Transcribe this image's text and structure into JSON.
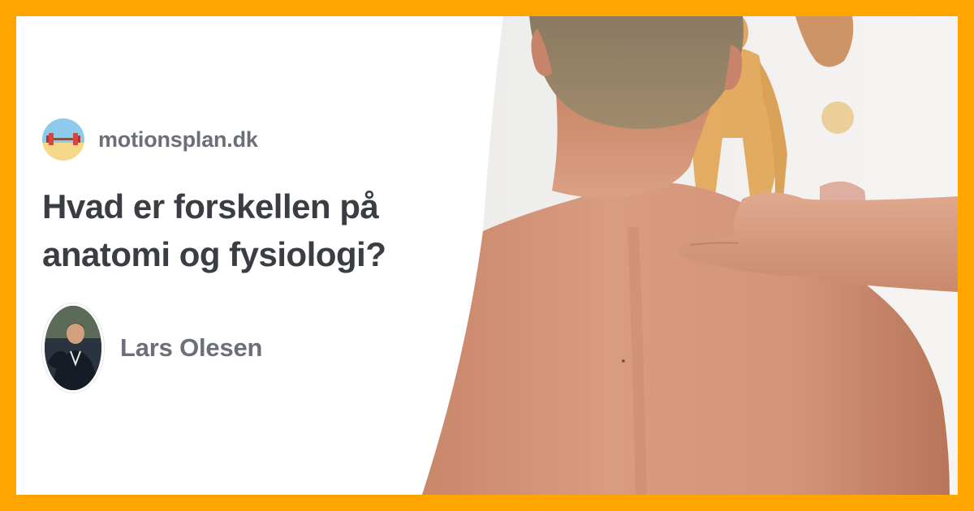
{
  "site": {
    "name": "motionsplan.dk",
    "logo_icon": "dumbbell-beach-icon"
  },
  "article": {
    "title": "Hvad er forskellen på anatomi og fysiologi?",
    "image_icon": "shoulder-massage-photo"
  },
  "author": {
    "name": "Lars Olesen",
    "avatar_icon": "author-avatar-photo"
  },
  "colors": {
    "frame": "#FFA500",
    "card_background": "#FFFFFF",
    "title_text": "#3A3D42",
    "muted_text": "#6B7078"
  }
}
